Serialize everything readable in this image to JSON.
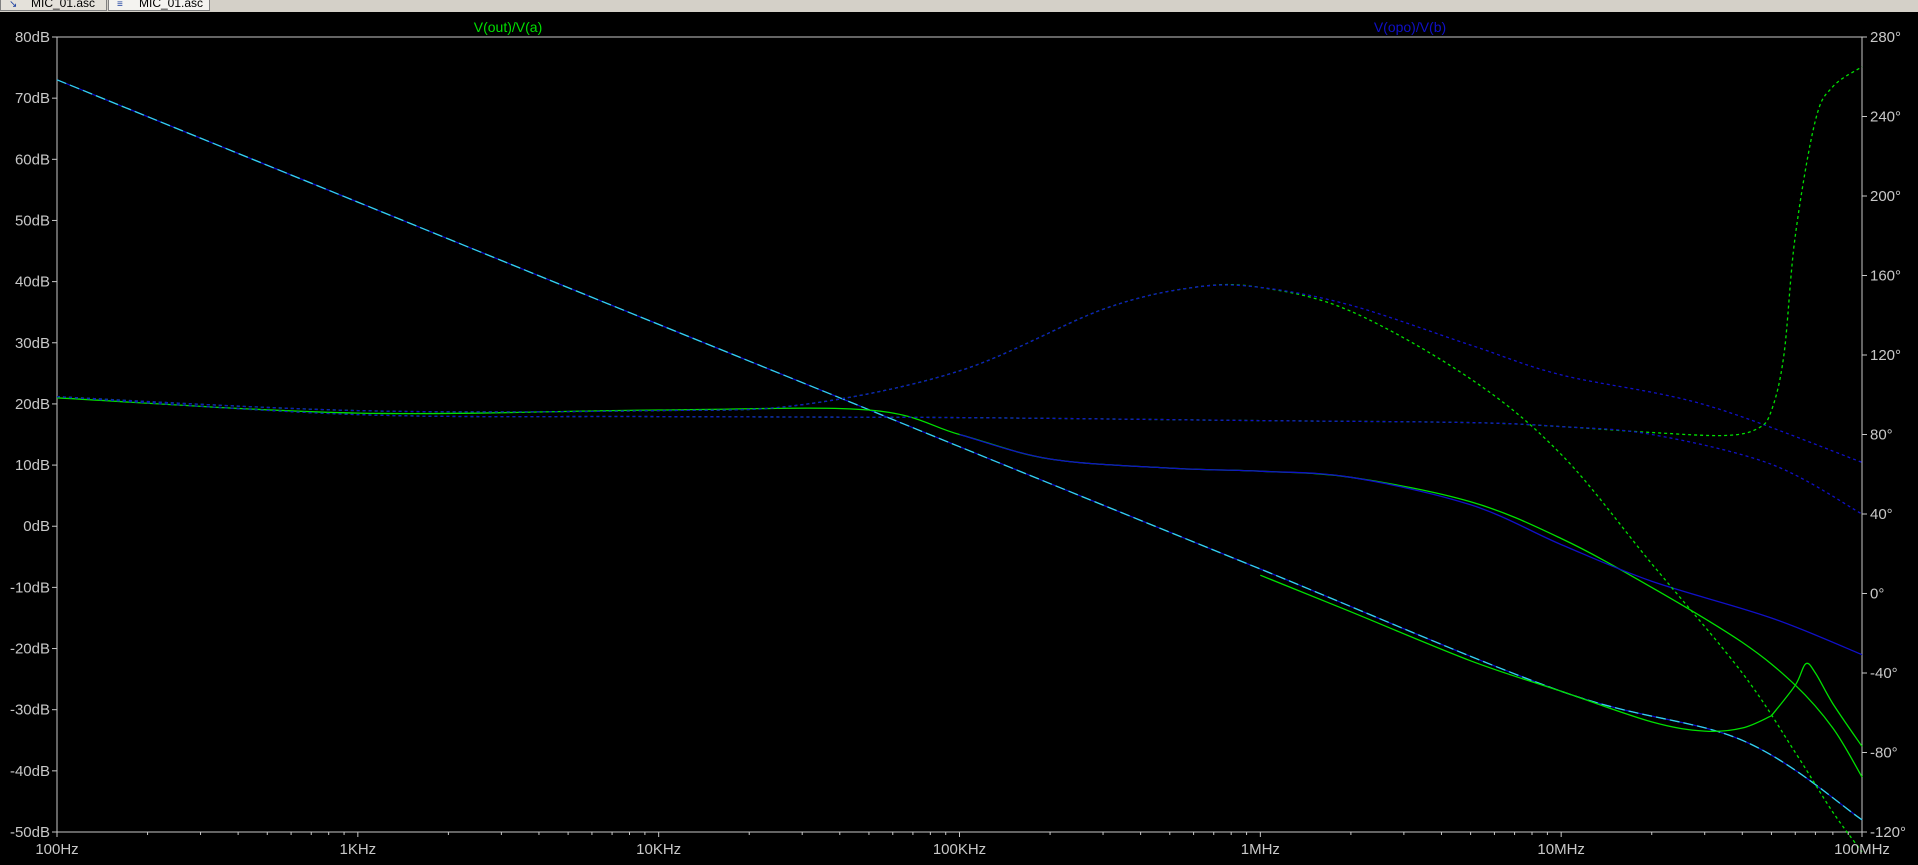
{
  "tabs": [
    {
      "label": "MIC_01.asc",
      "icon": "schematic-icon"
    },
    {
      "label": "MIC_01.asc",
      "icon": "waveform-icon"
    }
  ],
  "chart_data": {
    "type": "line",
    "x_scale": "log",
    "xlim": [
      100,
      100000000
    ],
    "ylim_left": [
      -50,
      80
    ],
    "ylim_right": [
      -120,
      280
    ],
    "x_ticks": [
      {
        "value": 100,
        "label": "100Hz"
      },
      {
        "value": 1000,
        "label": "1KHz"
      },
      {
        "value": 10000,
        "label": "10KHz"
      },
      {
        "value": 100000,
        "label": "100KHz"
      },
      {
        "value": 1000000,
        "label": "1MHz"
      },
      {
        "value": 10000000,
        "label": "10MHz"
      },
      {
        "value": 100000000,
        "label": "100MHz"
      }
    ],
    "y_left_ticks": [
      "80dB",
      "70dB",
      "60dB",
      "50dB",
      "40dB",
      "30dB",
      "20dB",
      "10dB",
      "0dB",
      "-10dB",
      "-20dB",
      "-30dB",
      "-40dB",
      "-50dB"
    ],
    "y_left_values": [
      80,
      70,
      60,
      50,
      40,
      30,
      20,
      10,
      0,
      -10,
      -20,
      -30,
      -40,
      -50
    ],
    "y_right_ticks": [
      "280°",
      "240°",
      "200°",
      "160°",
      "120°",
      "80°",
      "40°",
      "0°",
      "-40°",
      "-80°",
      "-120°"
    ],
    "y_right_values": [
      280,
      240,
      200,
      160,
      120,
      80,
      40,
      0,
      -40,
      -80,
      -120
    ],
    "background": "#000000",
    "axis_color": "#c8c8c8",
    "tick_label_color": "#c8c8c8",
    "series": [
      {
        "name": "V(out)/V(a)",
        "color": "#00e000",
        "legend_position": "top-left"
      },
      {
        "name": "V(opo)/V(b)",
        "color": "#1010c8",
        "legend_position": "top-right"
      }
    ],
    "curves": [
      {
        "series": 1,
        "kind": "magnitude",
        "axis": "left",
        "dash": "10 4",
        "overlay_color": "#33d4e8",
        "x": [
          100,
          1000,
          10000,
          40000,
          100000,
          1000000,
          10000000,
          40000000,
          100000000
        ],
        "y": [
          73,
          53,
          33,
          21,
          13,
          -7,
          -27,
          -35,
          -48
        ]
      },
      {
        "series": 0,
        "kind": "magnitude",
        "axis": "left",
        "dash": "",
        "x": [
          1000000,
          2000000,
          5000000,
          10000000,
          20000000,
          30000000,
          40000000,
          50000000
        ],
        "y": [
          -8,
          -14,
          -22,
          -27,
          -32,
          -33.5,
          -33,
          -31
        ]
      },
      {
        "series": 0,
        "kind": "magnitude",
        "axis": "left",
        "dash": "",
        "x": [
          50000000,
          60000000,
          65000000,
          70000000,
          80000000,
          100000000
        ],
        "y": [
          -31,
          -26,
          -22.5,
          -24,
          -29,
          -36
        ]
      },
      {
        "series": 0,
        "kind": "magnitude",
        "axis": "left",
        "dash": "",
        "x": [
          100,
          1000,
          10000,
          50000,
          100000,
          200000,
          500000,
          1000000,
          2000000,
          5000000,
          10000000,
          20000000,
          40000000,
          60000000,
          80000000,
          100000000
        ],
        "y": [
          21,
          18.5,
          19,
          19,
          15,
          11,
          9.5,
          9,
          8,
          4,
          -2,
          -10,
          -19,
          -26,
          -33,
          -41
        ]
      },
      {
        "series": 1,
        "kind": "magnitude",
        "axis": "left",
        "dash": "",
        "x": [
          100000,
          200000,
          500000,
          1000000,
          2000000,
          5000000,
          10000000,
          20000000,
          50000000,
          100000000
        ],
        "y": [
          15,
          11,
          9.5,
          9,
          8,
          3.5,
          -3,
          -9,
          -15,
          -21
        ]
      },
      {
        "series": 0,
        "kind": "phase",
        "axis": "right",
        "dash": "3 3",
        "x": [
          100,
          1000,
          10000,
          30000,
          100000,
          300000,
          600000,
          1000000,
          2000000,
          5000000,
          10000000,
          20000000,
          40000000,
          60000000,
          80000000,
          100000000
        ],
        "y": [
          99,
          92,
          92,
          95,
          112,
          143,
          154,
          154,
          142,
          108,
          70,
          15,
          -40,
          -80,
          -110,
          -130
        ]
      },
      {
        "series": 1,
        "kind": "phase",
        "axis": "right",
        "dash": "3 3",
        "x": [
          100,
          1000,
          10000,
          30000,
          100000,
          300000,
          600000,
          1000000,
          2000000,
          5000000,
          10000000,
          30000000,
          100000000
        ],
        "y": [
          99,
          92,
          92,
          95,
          112,
          143,
          154,
          154,
          145,
          125,
          110,
          95,
          66
        ]
      },
      {
        "series": 0,
        "kind": "phase",
        "axis": "right",
        "dash": "3 3",
        "x": [
          100,
          1000,
          10000,
          100000,
          1000000,
          5000000,
          10000000,
          20000000,
          35000000,
          45000000,
          50000000,
          55000000,
          60000000,
          70000000,
          80000000,
          100000000
        ],
        "y": [
          99,
          90,
          89,
          88.5,
          87,
          86,
          84,
          81,
          79.5,
          83,
          92,
          120,
          180,
          238,
          255,
          265
        ]
      },
      {
        "series": 1,
        "kind": "phase",
        "axis": "right",
        "dash": "3 3",
        "x": [
          100,
          1000,
          10000,
          100000,
          1000000,
          5000000,
          10000000,
          20000000,
          50000000,
          100000000
        ],
        "y": [
          99,
          90,
          89,
          88.5,
          87,
          86,
          84,
          80,
          65,
          40
        ]
      }
    ]
  }
}
